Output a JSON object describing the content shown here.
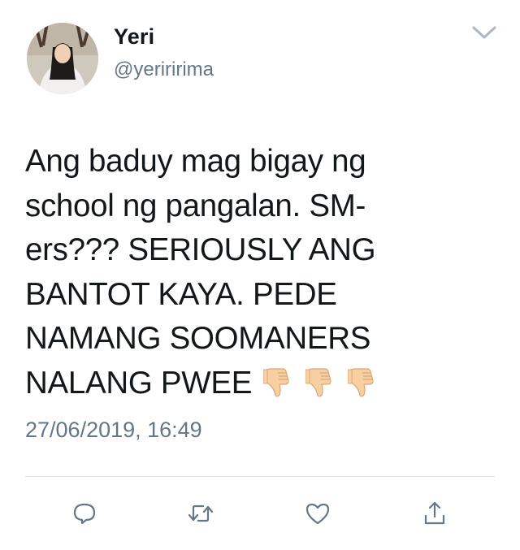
{
  "tweet": {
    "display_name": "Yeri",
    "handle": "@yeriririma",
    "text_lines": [
      "Ang baduy mag bigay ng",
      "school ng pangalan. SM-",
      "ers??? SERIOUSLY ANG",
      "BANTOT KAYA. PEDE",
      "NAMANG SOOMANERS",
      "NALANG PWEE"
    ],
    "emoji": [
      "thumbs-down-emoji",
      "thumbs-down-emoji",
      "thumbs-down-emoji"
    ],
    "timestamp": "27/06/2019, 16:49"
  },
  "icons": {
    "menu": "chevron-down-icon",
    "reply": "reply-icon",
    "retweet": "retweet-icon",
    "like": "heart-icon",
    "share": "share-icon"
  },
  "colors": {
    "text_primary": "#14171a",
    "text_secondary": "#657786",
    "divider": "#dfe3e6",
    "icon": "#657786",
    "emoji_skin": "#f7cfa3"
  }
}
